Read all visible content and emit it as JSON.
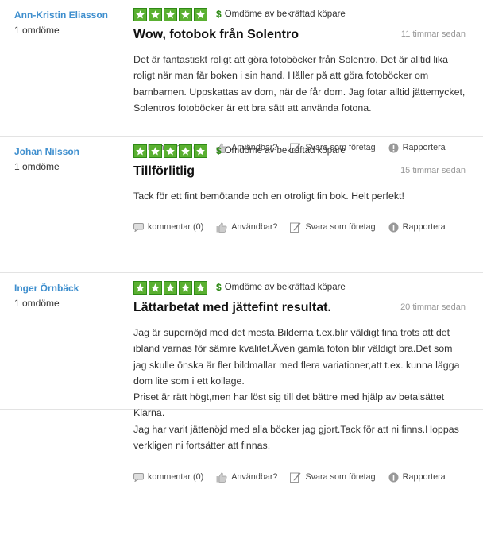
{
  "colors": {
    "author": "#3f8fce",
    "star": "#5ab031",
    "divider": "#e3e3e3"
  },
  "actions": {
    "comment_label": "kommentar (0)",
    "useful_label": "Användbar?",
    "reply_label": "Svara som företag",
    "report_label": "Rapportera"
  },
  "verified_label": "Omdöme av bekräftad köpare",
  "reviews": [
    {
      "author": "Ann-Kristin Eliasson",
      "count": "1 omdöme",
      "rating": 5,
      "title": "Wow, fotobok från Solentro",
      "time": "11 timmar sedan",
      "body": "Det är fantastiskt roligt att göra fotoböcker från Solentro. Det är alltid lika roligt när man får boken i sin hand. Håller på att göra fotoböcker om barnbarnen. Uppskattas av dom, när de får dom. Jag fotar alltid jättemycket, Solentros fotoböcker är ett bra sätt att använda fotona."
    },
    {
      "author": "Johan Nilsson",
      "count": "1 omdöme",
      "rating": 5,
      "title": "Tillförlitlig",
      "time": "15 timmar sedan",
      "body": "Tack för ett fint bemötande och en otroligt fin bok. Helt perfekt!"
    },
    {
      "author": "Inger Örnbäck",
      "count": "1 omdöme",
      "rating": 5,
      "title": "Lättarbetat med jättefint resultat.",
      "time": "20 timmar sedan",
      "body": "Jag är supernöjd med det mesta.Bilderna t.ex.blir väldigt fina trots att det ibland varnas för sämre kvalitet.Även gamla foton blir väldigt bra.Det som jag skulle önska är fler bildmallar med flera variationer,att t.ex. kunna lägga dom lite som i ett kollage.\nPriset är rätt högt,men har löst sig till det bättre med hjälp av betalsättet Klarna.\nJag har varit jättenöjd med alla böcker jag gjort.Tack för att ni finns.Hoppas verkligen ni fortsätter att finnas."
    }
  ]
}
